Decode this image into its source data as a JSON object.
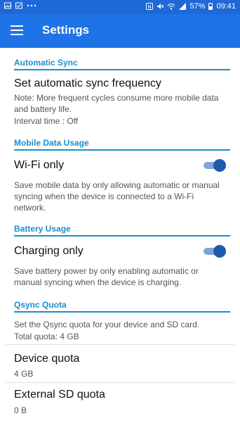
{
  "status_bar": {
    "left_icons": [
      "gallery-icon",
      "check-image-icon",
      "more-dots-icon"
    ],
    "battery": "57%",
    "time": "09:41"
  },
  "app_bar": {
    "title": "Settings"
  },
  "sections": {
    "auto_sync": {
      "header": "Automatic Sync",
      "title": "Set automatic sync frequency",
      "note": "Note: More frequent cycles consume more mobile data and battery life.",
      "interval": "Interval time : Off"
    },
    "mobile": {
      "header": "Mobile Data Usage",
      "title": "Wi-Fi only",
      "summary": "Save mobile data by only allowing automatic or manual syncing when the device is connected to a Wi-Fi network.",
      "enabled": true
    },
    "battery": {
      "header": "Battery Usage",
      "title": "Charging only",
      "summary": "Save battery power by only enabling automatic or manual syncing when the device is charging.",
      "enabled": true
    },
    "quota": {
      "header": "Qsync Quota",
      "summary": "Set the Qsync quota for your device and SD card.",
      "total": "Total quota: 4 GB",
      "device_title": "Device quota",
      "device_value": "4 GB",
      "sd_title": "External SD quota",
      "sd_value": "0 B"
    }
  },
  "colors": {
    "accent": "#1b8ecf",
    "app_bar": "#1e73e6",
    "switch_thumb": "#1e5aa8"
  }
}
